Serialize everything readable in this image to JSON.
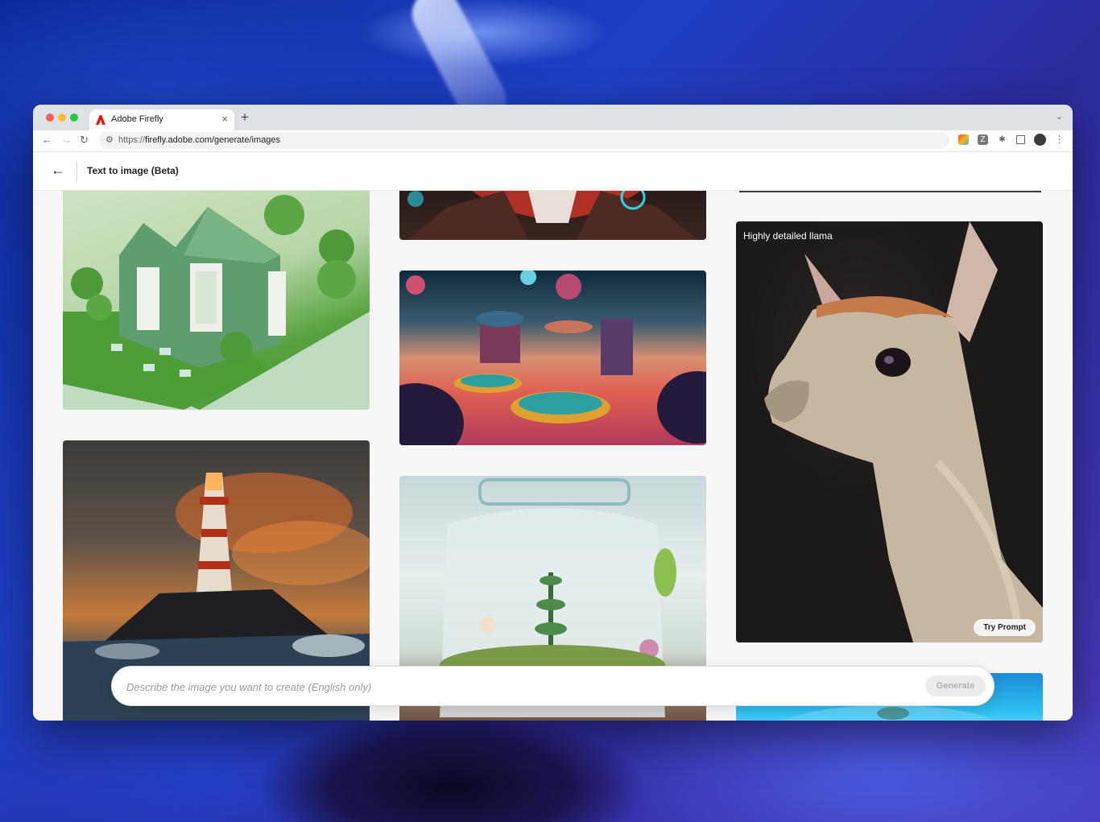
{
  "browser": {
    "tab_title": "Adobe Firefly",
    "url_scheme": "https://",
    "url_rest": "firefly.adobe.com/generate/images",
    "new_tab": "+",
    "tab_close": "×"
  },
  "app": {
    "back_icon": "←",
    "page_title": "Text to image (Beta)"
  },
  "gallery": {
    "cards": [
      {
        "name": "isometric-green-house",
        "label": ""
      },
      {
        "name": "sci-fi-carnival-planet",
        "label": ""
      },
      {
        "name": "portrait-leather-jacket",
        "label": ""
      },
      {
        "name": "lighthouse-storm",
        "label": ""
      },
      {
        "name": "terrarium-jar",
        "label": ""
      },
      {
        "name": "llama-portrait",
        "label": "Highly detailed llama",
        "button": "Try Prompt"
      }
    ]
  },
  "prompt": {
    "placeholder": "Describe the image you want to create (English only)",
    "generate_label": "Generate"
  },
  "colors": {
    "accent": "#eb1000",
    "generate_disabled_bg": "#ececec",
    "generate_disabled_text": "#b1b1b1"
  }
}
